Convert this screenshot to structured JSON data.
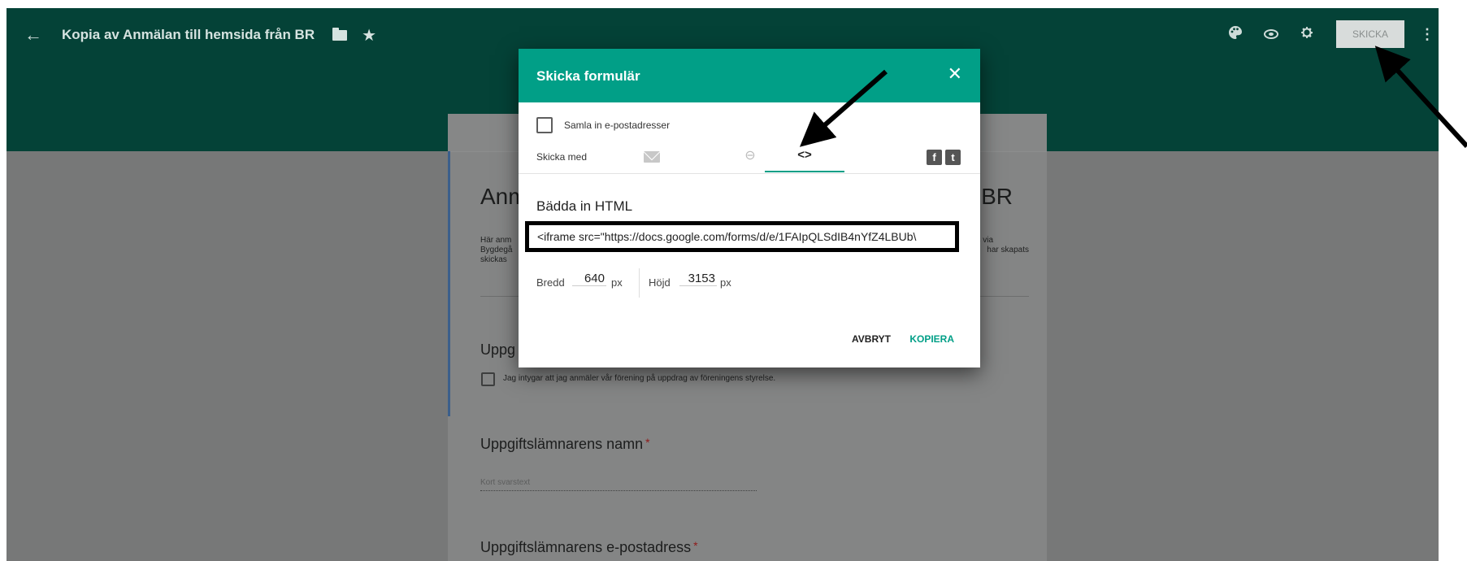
{
  "header": {
    "form_title": "Kopia av Anmälan till hemsida från BR",
    "send_button": "SKICKA"
  },
  "form": {
    "heading_start": "Anm",
    "heading_end": "BR",
    "desc_line1": "Här anm",
    "desc_line2": "Bygdegå",
    "desc_line3": "skickas",
    "desc_line1_end": "s via",
    "desc_line2_end": "har skapats",
    "section_label": "Uppg",
    "certify_text": "Jag intygar att jag anmäler vår förening på uppdrag av föreningens styrelse.",
    "question_name": "Uppgiftslämnarens namn",
    "question_email": "Uppgiftslämnarens e-postadress",
    "required_mark": "*",
    "short_answer_placeholder": "Kort svarstext"
  },
  "dialog": {
    "title": "Skicka formulär",
    "close_icon_glyph": "✕",
    "collect_emails_label": "Samla in e-postadresser",
    "send_with_label": "Skicka med",
    "link_glyph": "⊖",
    "embed_glyph": "<>",
    "facebook_glyph": "f",
    "twitter_glyph": "t",
    "embed_heading": "Bädda in HTML",
    "embed_code": "<iframe src=\"https://docs.google.com/forms/d/e/1FAIpQLSdIB4nYfZ4LBUb\\",
    "width_label": "Bredd",
    "width_value": "640",
    "height_label": "Höjd",
    "height_value": "3153",
    "unit": "px",
    "cancel_label": "AVBRYT",
    "copy_label": "KOPIERA"
  },
  "icons": {
    "back": "arrow-left-icon",
    "folder": "folder-icon",
    "star": "star-icon",
    "palette": "palette-icon",
    "preview": "eye-icon",
    "settings": "gear-icon",
    "more": "more-vert-icon",
    "close": "close-icon",
    "email": "mail-icon",
    "link": "link-icon",
    "embed": "code-icon",
    "facebook": "facebook-icon",
    "twitter": "twitter-icon"
  },
  "colors": {
    "header_bg": "#044237",
    "dialog_accent": "#019f87",
    "overlay_bg": "#777878",
    "highlight_border": "#000000"
  }
}
